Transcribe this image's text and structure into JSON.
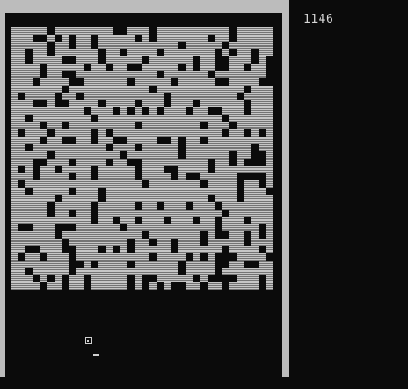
{
  "hud": {
    "score": "1146"
  },
  "colors": {
    "frame": "#bcbcbc",
    "background": "#0b0b0b",
    "brick": "#c6c6c6",
    "text": "#d6d6d6"
  },
  "wall": {
    "columns": 36,
    "rows": 36,
    "rows_map": [
      "1111101111111100111011111111110111111",
      "1110010101101111101011111110110111111",
      "1111101101101111111111101111101111111",
      "1101101111110110111101111111010110111",
      "1101111001110111110111111011001110101",
      "1111011111011011001111101011001101101",
      "1111011001111111111101111110111111101",
      "1110111100111111011111011111001111001",
      "1111111011111111111011111111111101111",
      "1011110110111111111110111111111011111",
      "1110010011110111101110111011111101111",
      "1111111111011101010101110110011101111",
      "1101111111101111111111111111101111111",
      "1111011011111111101111111101110111111",
      "1011101111101011111111111111101101011",
      "1111011001101100111100101101111111111",
      "1101111111111011101111101111111110111",
      "1111101111111110111111101111110110011",
      "1110011101111011001111111110110100011",
      "1010110111101111101110011110111111111",
      "1110111101101111101111010011111000011",
      "1011111111111111110111111101111011011",
      "1101111101110111111111111111111011101",
      "1111110111110111111111111110111011111",
      "1111101111101111101101110111011111111",
      "1111101101101111111111111111101111111",
      "1111111111101101101110111011011101111",
      "1001110001111110111111111111011111011",
      "1111110111111111110111111101001101011",
      "1111111011111111011011011101111101111",
      "1100111001110101011111011111101111011",
      "1011011101111111111011110101000111101",
      "1111111100101111011111101111001100111",
      "1101111101111111111111101111011111111",
      "1110101011011111010011111010000111011",
      "1111011011011111010101001101101111011"
    ]
  }
}
